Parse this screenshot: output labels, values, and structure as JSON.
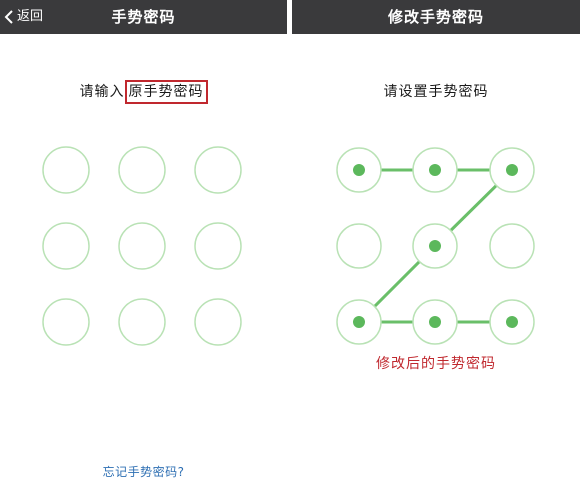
{
  "left": {
    "nav": {
      "back_label": "返回",
      "title": "手势密码"
    },
    "prompt": {
      "prefix": "请输入",
      "highlight": "原手势密码"
    },
    "forgot_link": "忘记手势密码?"
  },
  "right": {
    "nav": {
      "title": "修改手势密码"
    },
    "prompt": "请设置手势密码",
    "annotation": "修改后的手势密码",
    "pattern_sequence": [
      1,
      2,
      3,
      5,
      7,
      8,
      9
    ]
  },
  "colors": {
    "nav_bg": "#3a3a3c",
    "circle_stroke": "#b9e2b5",
    "active_fill": "#5cb85c",
    "line": "#6abf69",
    "highlight_border": "#c0282e",
    "annotation": "#c0282e",
    "link": "#2e6fb3"
  }
}
